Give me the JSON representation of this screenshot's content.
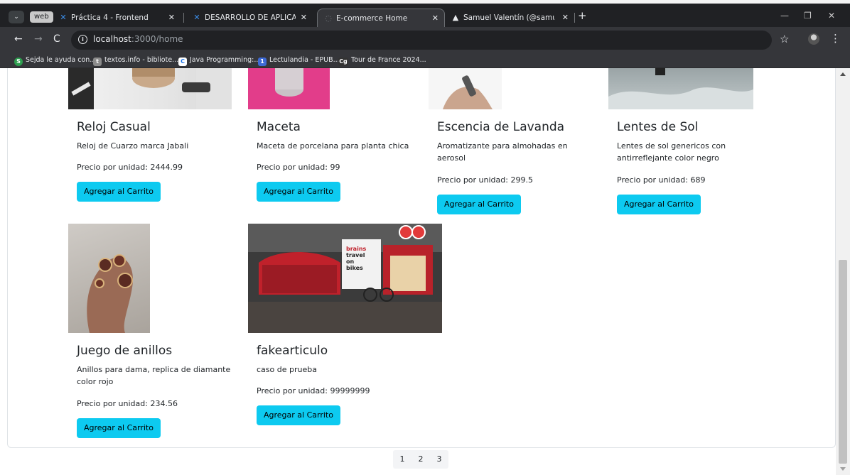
{
  "browser": {
    "workspace_label": "web",
    "tabs": [
      {
        "title": "Práctica 4 - Frontend",
        "close": "✕"
      },
      {
        "title": "DESARROLLO DE APLICACIONES",
        "close": "✕"
      },
      {
        "title": "E-commerce Home",
        "close": "✕"
      },
      {
        "title": "Samuel Valentín (@samuel_vale",
        "close": "✕"
      }
    ],
    "new_tab": "+",
    "url_host": "localhost",
    "url_path": ":3000/home",
    "bookmarks": [
      {
        "label": "Sejda le ayuda con...",
        "icon": "S",
        "color": "#2e9e4f"
      },
      {
        "label": "textos.info - bibliote...",
        "icon": "t",
        "color": "#8b8b8b"
      },
      {
        "label": "Java Programming:...",
        "icon": "C",
        "color": "#1a73e8"
      },
      {
        "label": "Lectulandia - EPUB...",
        "icon": "1",
        "color": "#3d6ad6"
      },
      {
        "label": "Tour de France 2024...",
        "icon": "Cg",
        "color": "#333333"
      }
    ]
  },
  "products": [
    {
      "name": "Reloj Casual",
      "description": "Reloj de Cuarzo marca Jabali",
      "price_label": "Precio por unidad: 2444.99",
      "button": "Agregar al Carrito"
    },
    {
      "name": "Maceta",
      "description": "Maceta de porcelana para planta chica",
      "price_label": "Precio por unidad: 99",
      "button": "Agregar al Carrito"
    },
    {
      "name": "Escencia de Lavanda",
      "description": "Aromatizante para almohadas en aerosol",
      "price_label": "Precio por unidad: 299.5",
      "button": "Agregar al Carrito"
    },
    {
      "name": "Lentes de Sol",
      "description": "Lentes de sol genericos con antirreflejante color negro",
      "price_label": "Precio por unidad: 689",
      "button": "Agregar al Carrito"
    },
    {
      "name": "Juego de anillos",
      "description": "Anillos para dama, replica de diamante color rojo",
      "price_label": "Precio por unidad: 234.56",
      "button": "Agregar al Carrito"
    },
    {
      "name": "fakearticulo",
      "description": "caso de prueba",
      "price_label": "Precio por unidad: 99999999",
      "button": "Agregar al Carrito",
      "image_sign": [
        "brains",
        "travel",
        "on",
        "bikes"
      ]
    }
  ],
  "pagination": [
    "1",
    "2",
    "3"
  ],
  "colors": {
    "button": "#0dcaf0",
    "chrome_dark": "#202124",
    "toolbar": "#35363a"
  }
}
